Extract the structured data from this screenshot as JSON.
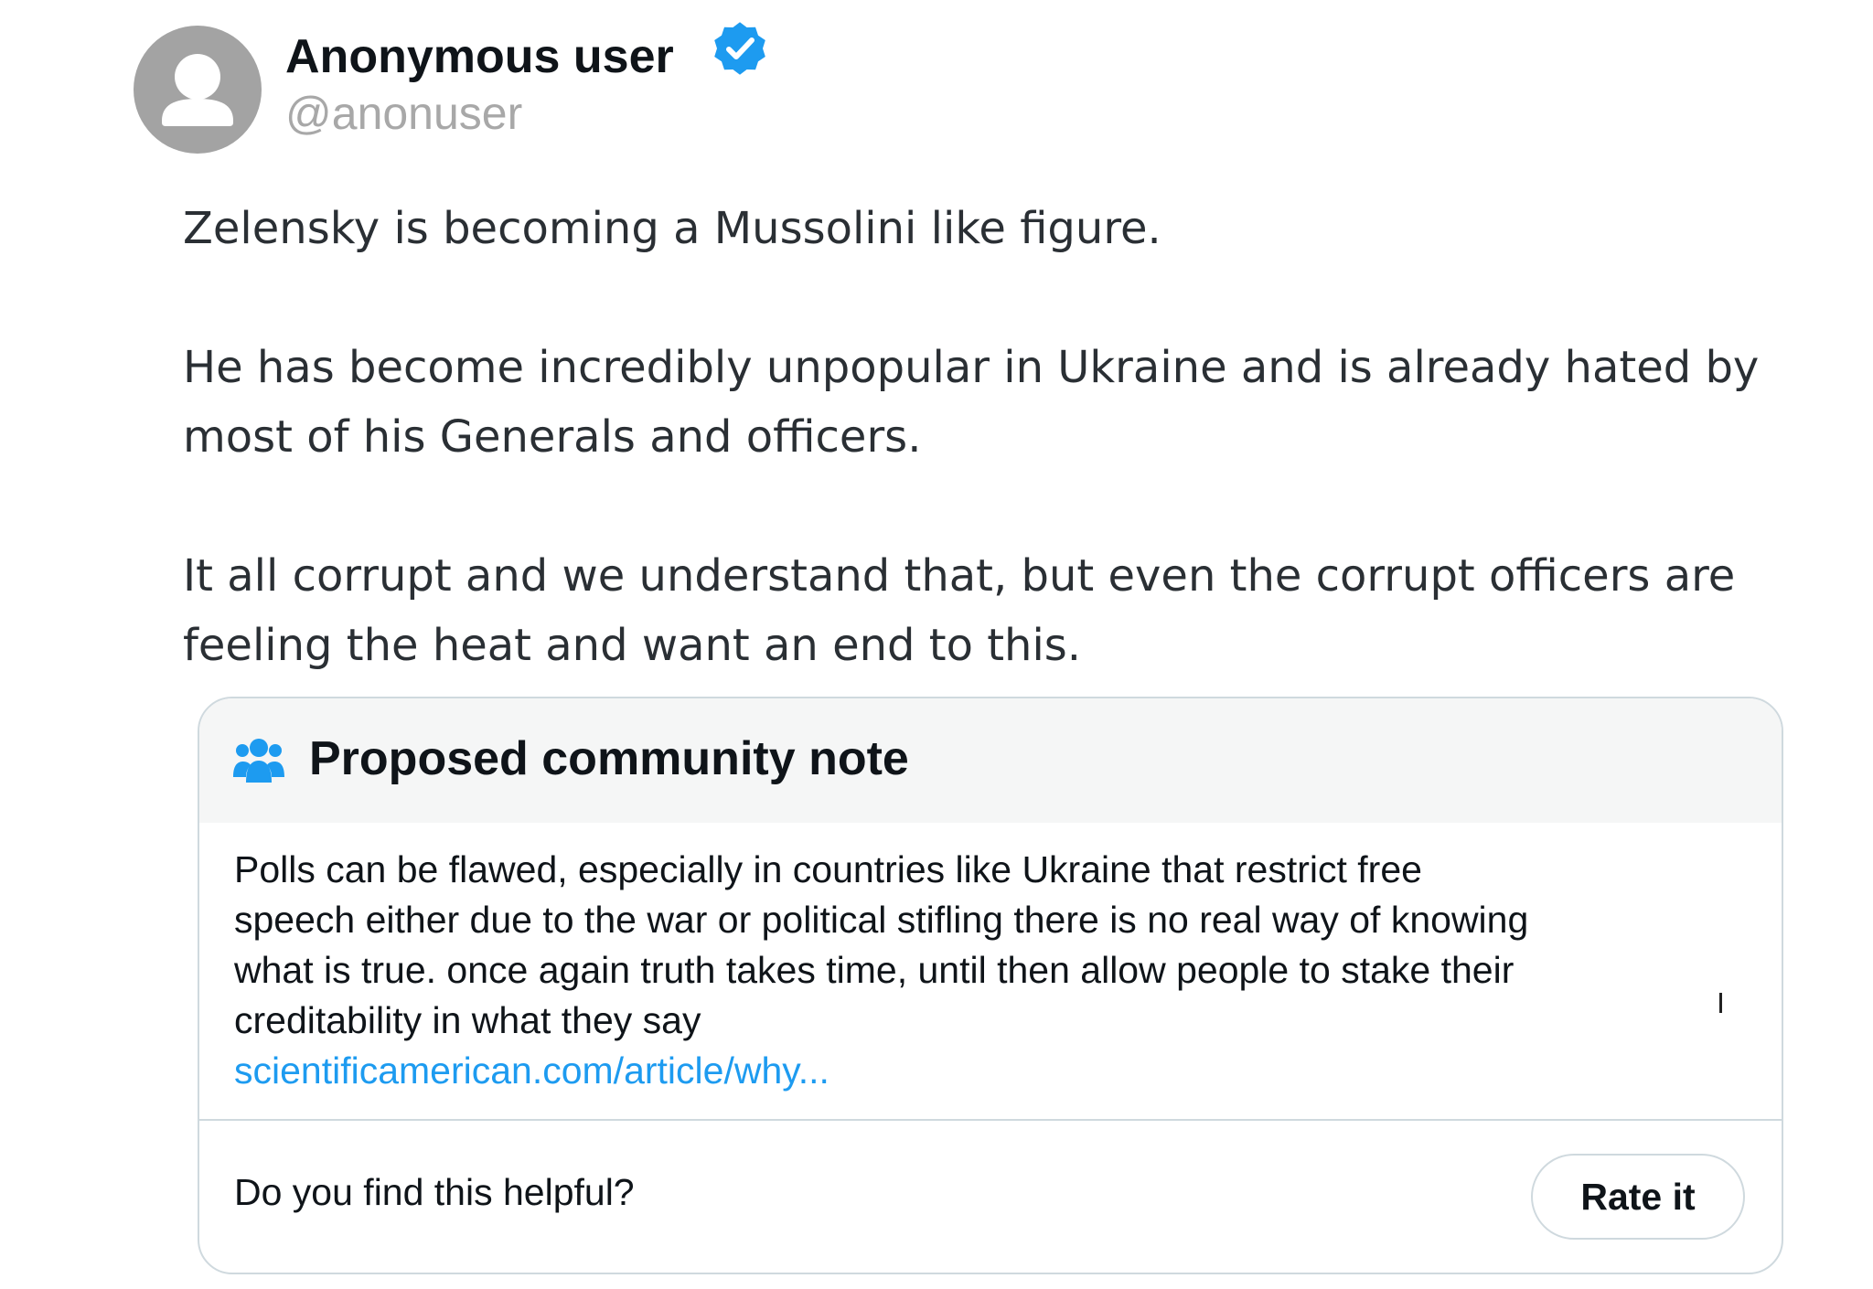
{
  "author": {
    "display_name": "Anonymous user",
    "handle": "@anonuser",
    "avatar_icon": "default-avatar-icon",
    "verified_icon": "verified-badge-icon",
    "verified_color": "#1d9bf0"
  },
  "tweet": {
    "paragraphs": [
      [
        "Zelensky is becoming a Mussolini like figure."
      ],
      [
        "He has become incredibly unpopular in Ukraine and is already hated by",
        "most of his Generals and officers."
      ],
      [
        "It all corrupt and we understand that, but even the corrupt officers are",
        "feeling the heat and want an end to this."
      ]
    ]
  },
  "community_note": {
    "icon": "people-group-icon",
    "title": "Proposed community note",
    "body_lines": [
      "Polls can be flawed, especially in countries like Ukraine that restrict free",
      "speech either due to the war or political stifling there is no real way of knowing",
      "what is true.  once again truth takes time, until then allow people to stake their",
      "creditability  in what they say"
    ],
    "link_text": "scientificamerican.com/article/why...",
    "link_color": "#1d9bf0",
    "helpful_question": "Do you find this helpful?",
    "rate_button_label": "Rate it"
  }
}
